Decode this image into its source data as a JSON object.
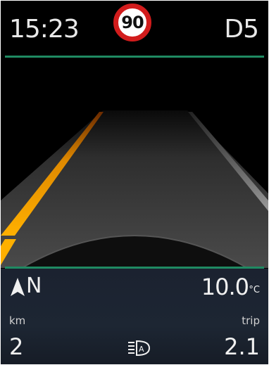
{
  "header": {
    "time": "15:23",
    "speed_limit": "90",
    "gear": "D5"
  },
  "status": {
    "heading": "N",
    "temperature": "10.0",
    "temperature_unit": "°C",
    "left_label": "km",
    "left_value": "2",
    "right_label": "trip",
    "right_value": "2.1"
  },
  "colors": {
    "accent_green": "#1f8a62",
    "lane_orange": "#f5a000",
    "sign_red": "#d21c1c"
  },
  "icons": [
    "compass-arrow-icon",
    "auto-headlight-icon",
    "speed-limit-sign"
  ]
}
